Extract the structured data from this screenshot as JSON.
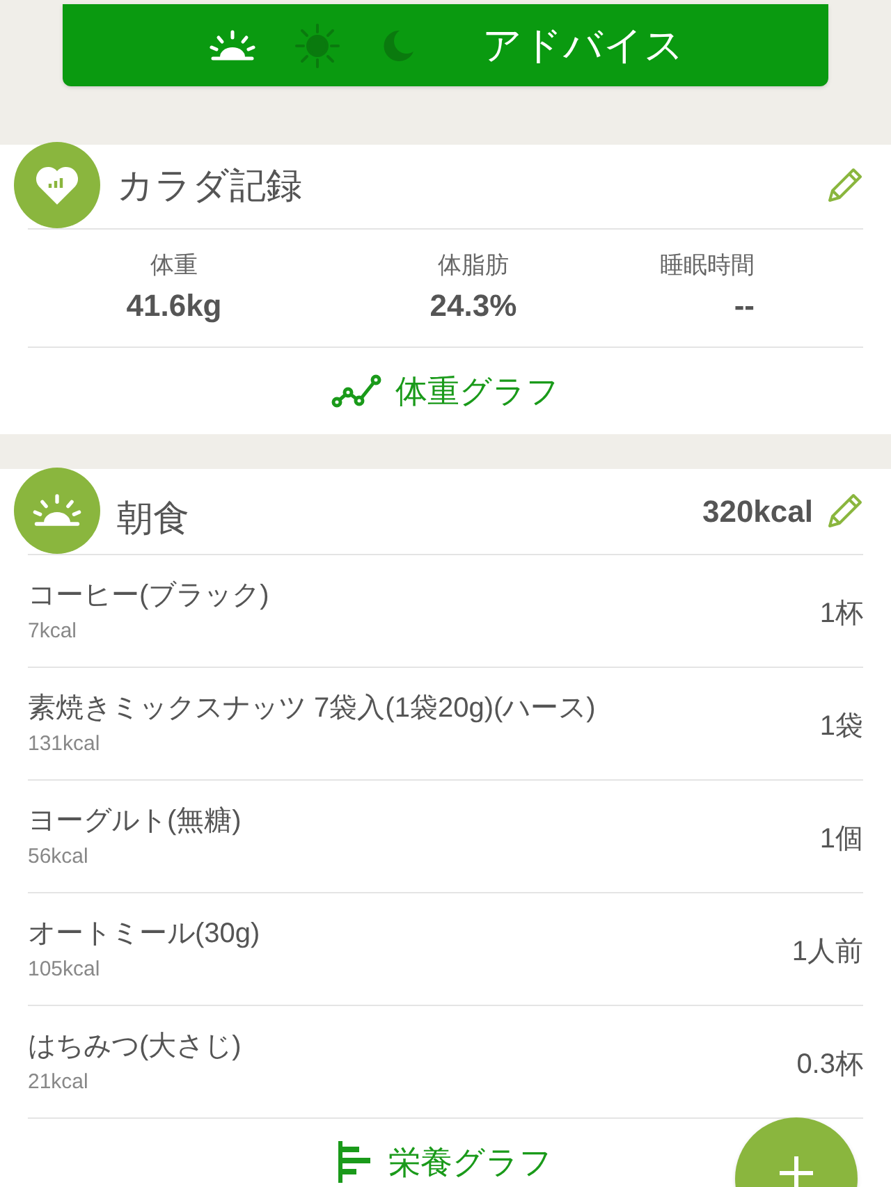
{
  "advice_bar": {
    "times": [
      {
        "kind": "morning",
        "selected": true
      },
      {
        "kind": "noon",
        "selected": false
      },
      {
        "kind": "night",
        "selected": false
      }
    ],
    "label": "アドバイス"
  },
  "body_record": {
    "title": "カラダ記録",
    "stats": [
      {
        "label": "体重",
        "value": "41.6kg"
      },
      {
        "label": "体脂肪",
        "value": "24.3%"
      },
      {
        "label": "睡眠時間",
        "value": "--"
      }
    ],
    "graph_link": "体重グラフ"
  },
  "breakfast": {
    "title": "朝食",
    "total": "320kcal",
    "items": [
      {
        "name": "コーヒー(ブラック)",
        "kcal": "7kcal",
        "amount": "1杯"
      },
      {
        "name": "素焼きミックスナッツ 7袋入(1袋20g)(ハース)",
        "kcal": "131kcal",
        "amount": "1袋"
      },
      {
        "name": "ヨーグルト(無糖)",
        "kcal": "56kcal",
        "amount": "1個"
      },
      {
        "name": "オートミール(30g)",
        "kcal": "105kcal",
        "amount": "1人前"
      },
      {
        "name": "はちみつ(大さじ)",
        "kcal": "21kcal",
        "amount": "0.3杯"
      }
    ],
    "graph_link": "栄養グラフ"
  }
}
